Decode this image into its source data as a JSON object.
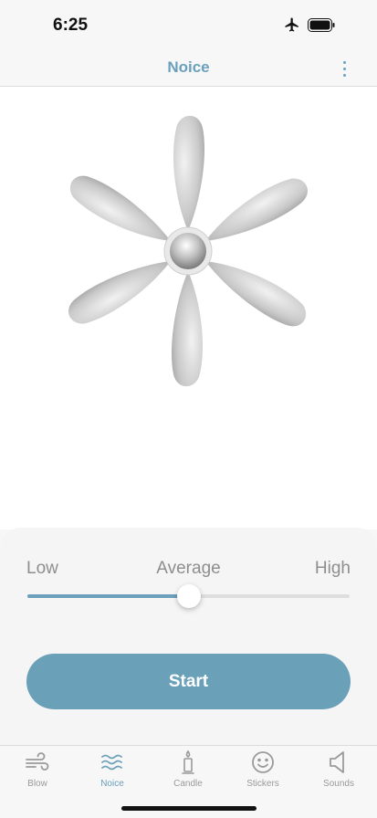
{
  "status_bar": {
    "time": "6:25"
  },
  "nav": {
    "title": "Noice",
    "more_icon": "more-vertical-icon"
  },
  "controls": {
    "low_label": "Low",
    "average_label": "Average",
    "high_label": "High",
    "speed_level": 0.5,
    "start_label": "Start"
  },
  "tabs": [
    {
      "label": "Blow",
      "icon": "wind-icon",
      "active": false
    },
    {
      "label": "Noice",
      "icon": "waves-icon",
      "active": true
    },
    {
      "label": "Candle",
      "icon": "candle-icon",
      "active": false
    },
    {
      "label": "Stickers",
      "icon": "smiley-icon",
      "active": false
    },
    {
      "label": "Sounds",
      "icon": "speaker-icon",
      "active": false
    }
  ],
  "colors": {
    "accent": "#6aa0bb",
    "button": "#6aa0b8",
    "inactive": "#9a9a9a"
  }
}
